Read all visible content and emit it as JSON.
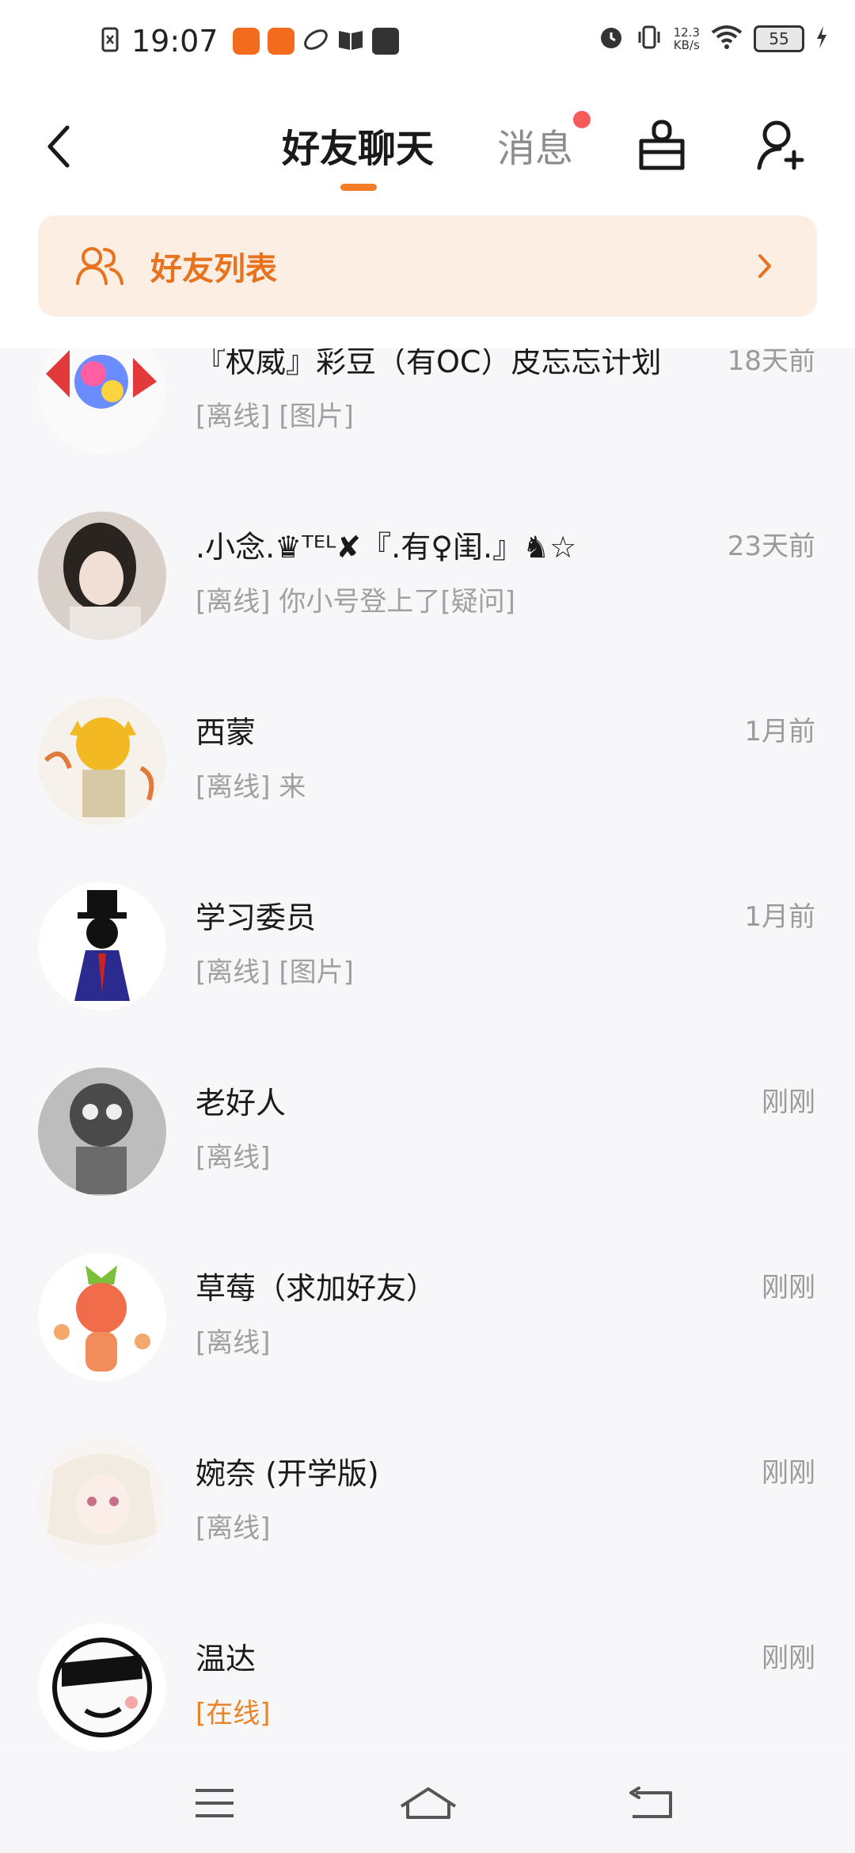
{
  "status_bar": {
    "time": "19:07",
    "network_speed_value": "12.3",
    "network_speed_unit": "KB/s",
    "battery": "55",
    "icons": [
      "sim-icon",
      "app-badge-icon",
      "app-badge-icon",
      "leaf-icon",
      "book-icon",
      "vivo-icon",
      "alarm-icon",
      "vibrate-icon",
      "wifi-icon",
      "battery-icon",
      "charging-icon"
    ]
  },
  "header": {
    "tab_friends": "好友聊天",
    "tab_messages": "消息",
    "messages_has_unread": true,
    "accent_color": "#f47c24",
    "unread_dot_color": "#f85a5a"
  },
  "banner": {
    "label": "好友列表",
    "background": "#fdeee3"
  },
  "chats": [
    {
      "name": "『权威』彩豆（有OC）皮忘忘计划",
      "time": "18天前",
      "message": "[离线] [图片]",
      "online": false
    },
    {
      "name": ".小念.♛ᵀᴱᴸ✘『.有♀闺.』♞☆",
      "time": "23天前",
      "message": "[离线] 你小号登上了[疑问]",
      "online": false
    },
    {
      "name": "西蒙",
      "time": "1月前",
      "message": "[离线] 来",
      "online": false
    },
    {
      "name": "学习委员",
      "time": "1月前",
      "message": "[离线] [图片]",
      "online": false
    },
    {
      "name": "老好人",
      "time": "刚刚",
      "message": "[离线]",
      "online": false
    },
    {
      "name": "草莓（求加好友）",
      "time": "刚刚",
      "message": "[离线]",
      "online": false
    },
    {
      "name": "婉奈 (开学版)",
      "time": "刚刚",
      "message": "[离线]",
      "online": false
    },
    {
      "name": "温达",
      "time": "刚刚",
      "message": "[在线]",
      "online": true
    }
  ],
  "nav": {
    "icons": [
      "menu-icon",
      "home-icon",
      "back-icon"
    ]
  }
}
